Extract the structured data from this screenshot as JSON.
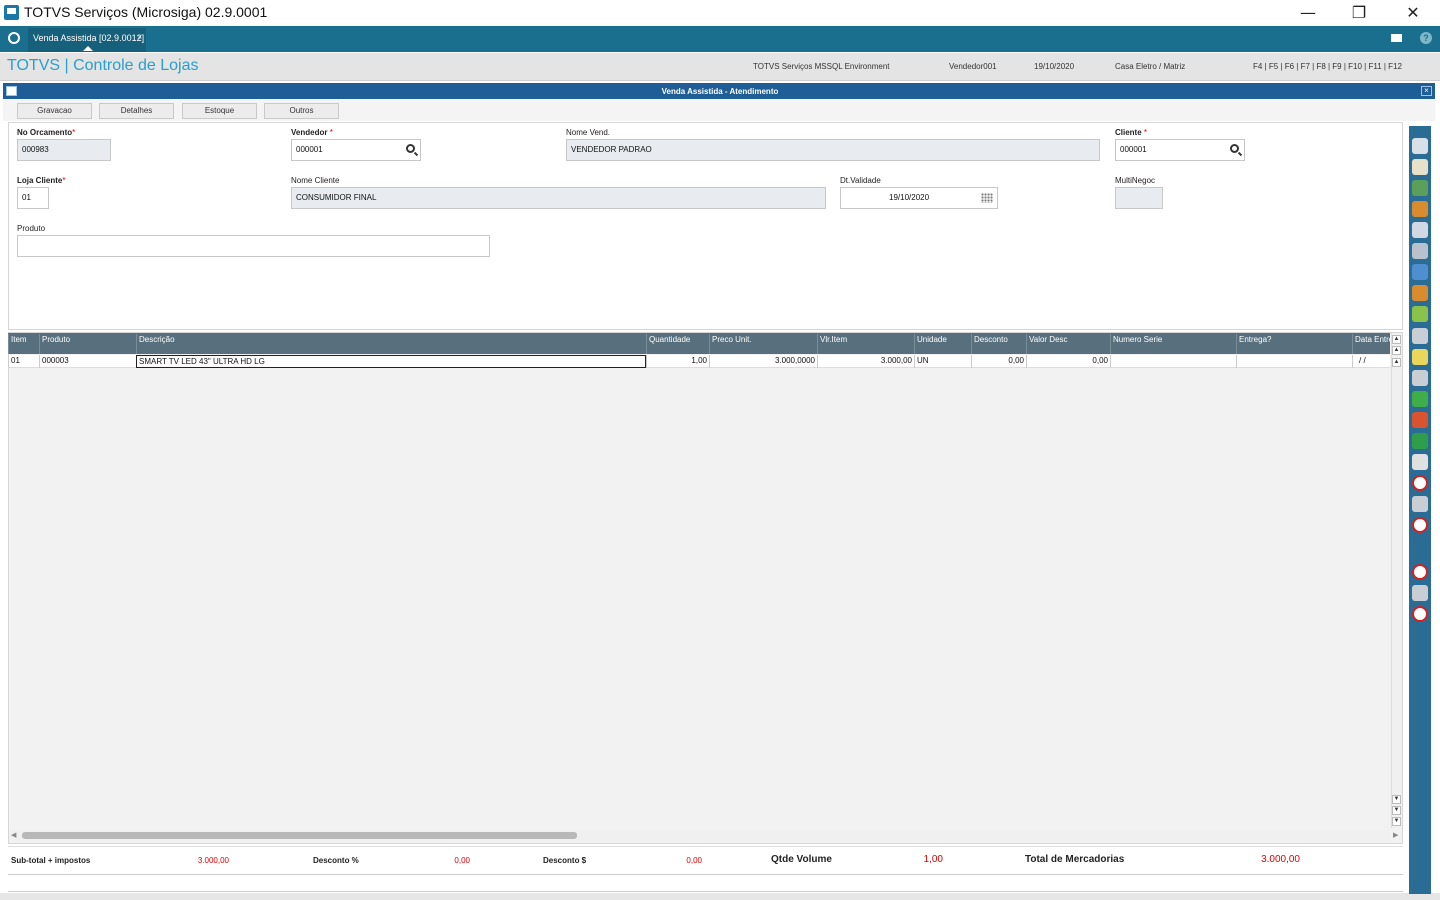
{
  "window": {
    "title": "TOTVS Serviços (Microsiga) 02.9.0001",
    "minimize": "—",
    "maximize": "❐",
    "close": "✕"
  },
  "tabs": [
    {
      "label": "Venda Assistida [02.9.0012]",
      "close": "×"
    }
  ],
  "header": {
    "brand": "TOTVS | Controle de Lojas",
    "environment": "TOTVS Serviços MSSQL Environment",
    "user": "Vendedor001",
    "date": "19/10/2020",
    "branch": "Casa Eletro / Matriz",
    "shortcuts": "F4 | F5 | F6 | F7 | F8 | F9 | F10 | F11 | F12"
  },
  "dialog": {
    "title": "Venda Assistida - Atendimento",
    "close": "×"
  },
  "toolbar": {
    "buttons": [
      "Gravacao",
      "Detalhes",
      "Estoque",
      "Outros"
    ]
  },
  "form": {
    "orcamento": {
      "label": "No Orcamento",
      "value": "000983"
    },
    "vendedor": {
      "label": "Vendedor",
      "value": "000001"
    },
    "nome_vend": {
      "label": "Nome Vend.",
      "value": "VENDEDOR PADRAO"
    },
    "cliente": {
      "label": "Cliente",
      "value": "000001"
    },
    "loja_cliente": {
      "label": "Loja Cliente",
      "value": "01"
    },
    "nome_cliente": {
      "label": "Nome Cliente",
      "value": "CONSUMIDOR FINAL"
    },
    "dt_validade": {
      "label": "Dt.Validade",
      "value": "19/10/2020"
    },
    "multinegoc": {
      "label": "MultiNegoc",
      "value": ""
    },
    "produto": {
      "label": "Produto",
      "value": ""
    },
    "required_mark": "*"
  },
  "grid": {
    "columns": [
      "Item",
      "Produto",
      "Descrição",
      "Quantidade",
      "Preco Unit.",
      "Vlr.Item",
      "Unidade",
      "Desconto",
      "Valor Desc",
      "Numero Serie",
      "Entrega?",
      "Data Entre"
    ],
    "rows": [
      {
        "item": "01",
        "produto": "000003",
        "descricao": "SMART TV LED 43\" ULTRA HD LG",
        "quantidade": "1,00",
        "preco_unit": "3.000,0000",
        "vlr_item": "3.000,00",
        "unidade": "UN",
        "desconto": "0,00",
        "valor_desc": "0,00",
        "numero_serie": "",
        "entrega": "",
        "data_entrega": "/ /"
      }
    ]
  },
  "totals": {
    "subtotal": {
      "label": "Sub-total + impostos",
      "value": "3.000,00"
    },
    "desconto_pct": {
      "label": "Desconto %",
      "value": "0,00"
    },
    "desconto_val": {
      "label": "Desconto $",
      "value": "0,00"
    },
    "qtde_volume": {
      "label": "Qtde Volume",
      "value": "1,00"
    },
    "total_mercadorias": {
      "label": "Total de Mercadorias",
      "value": "3.000,00"
    }
  },
  "sidebar_icons": [
    "save-icon",
    "edit-icon",
    "exit-icon",
    "box-icon",
    "search-doc-icon",
    "truck-icon",
    "exchange-icon",
    "package-icon",
    "money-icon",
    "key-icon",
    "calc-icon",
    "link-icon",
    "refresh-icon",
    "gift-icon",
    "dollar-icon",
    "dice-icon",
    "clock-icon",
    "transfer-icon",
    "target-icon",
    "clock-icon-2",
    "transfer-icon-2",
    "target-icon-2"
  ],
  "colors": {
    "tabbar": "#1a6f8e",
    "brand": "#2a9fc9",
    "dialog_title": "#1f5d96",
    "grid_header": "#58707e",
    "sidebar": "#2a6c93",
    "total_values": "#e00000"
  }
}
